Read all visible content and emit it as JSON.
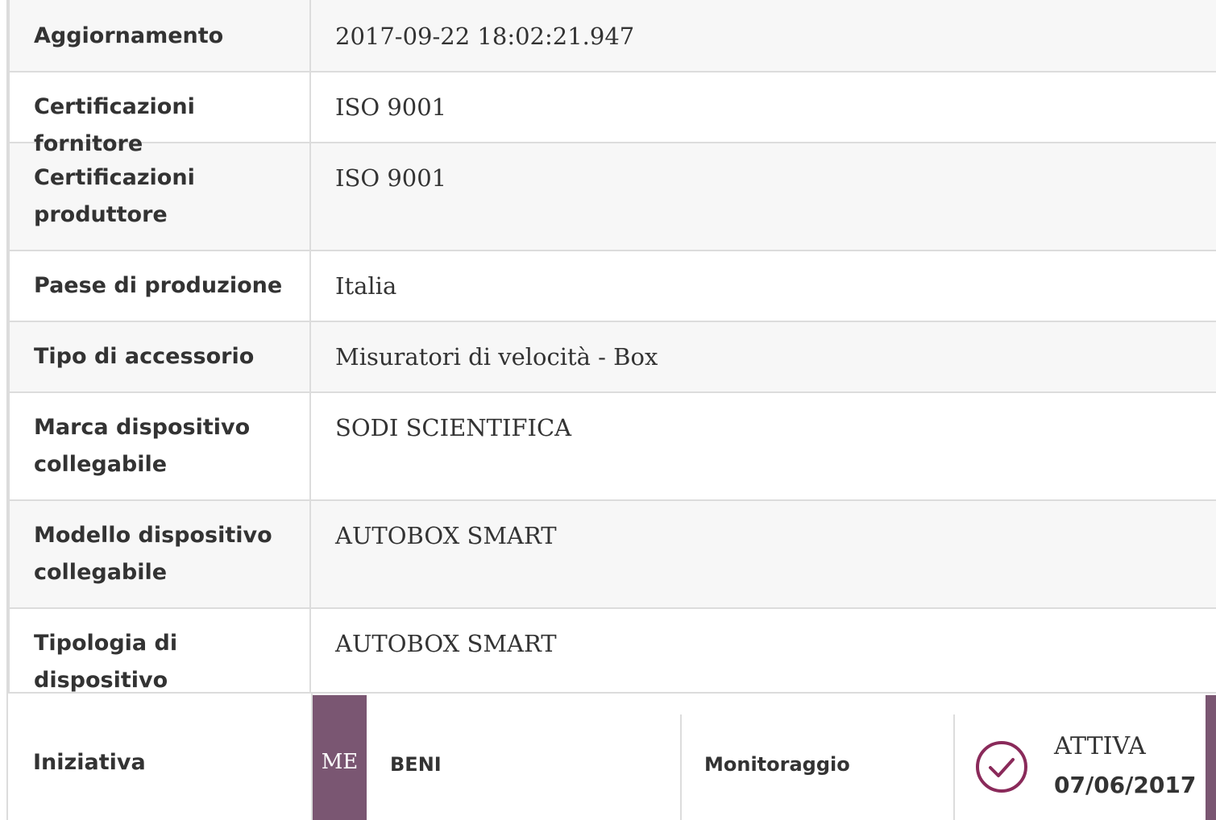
{
  "details": [
    {
      "label": "Aggiornamento",
      "value": "2017-09-22 18:02:21.947"
    },
    {
      "label": "Certificazioni fornitore",
      "value": "ISO 9001"
    },
    {
      "label": "Certificazioni produttore",
      "value": "ISO 9001"
    },
    {
      "label": "Paese di produzione",
      "value": "Italia"
    },
    {
      "label": "Tipo di accessorio",
      "value": "Misuratori di velocità - Box"
    },
    {
      "label": "Marca dispositivo collegabile",
      "value": "SODI SCIENTIFICA"
    },
    {
      "label": "Modello dispositivo collegabile",
      "value": "AUTOBOX SMART"
    },
    {
      "label": "Tipologia di dispositivo collegabile",
      "value": "AUTOBOX SMART"
    }
  ],
  "iniziativa": {
    "label": "Iniziativa",
    "badge": "ME",
    "category": "BENI",
    "monitoring_label": "Monitoraggio",
    "status": "ATTIVA",
    "status_date": "07/06/2017",
    "status_icon": "check-circle-icon",
    "accent_color": "#7a5672"
  }
}
